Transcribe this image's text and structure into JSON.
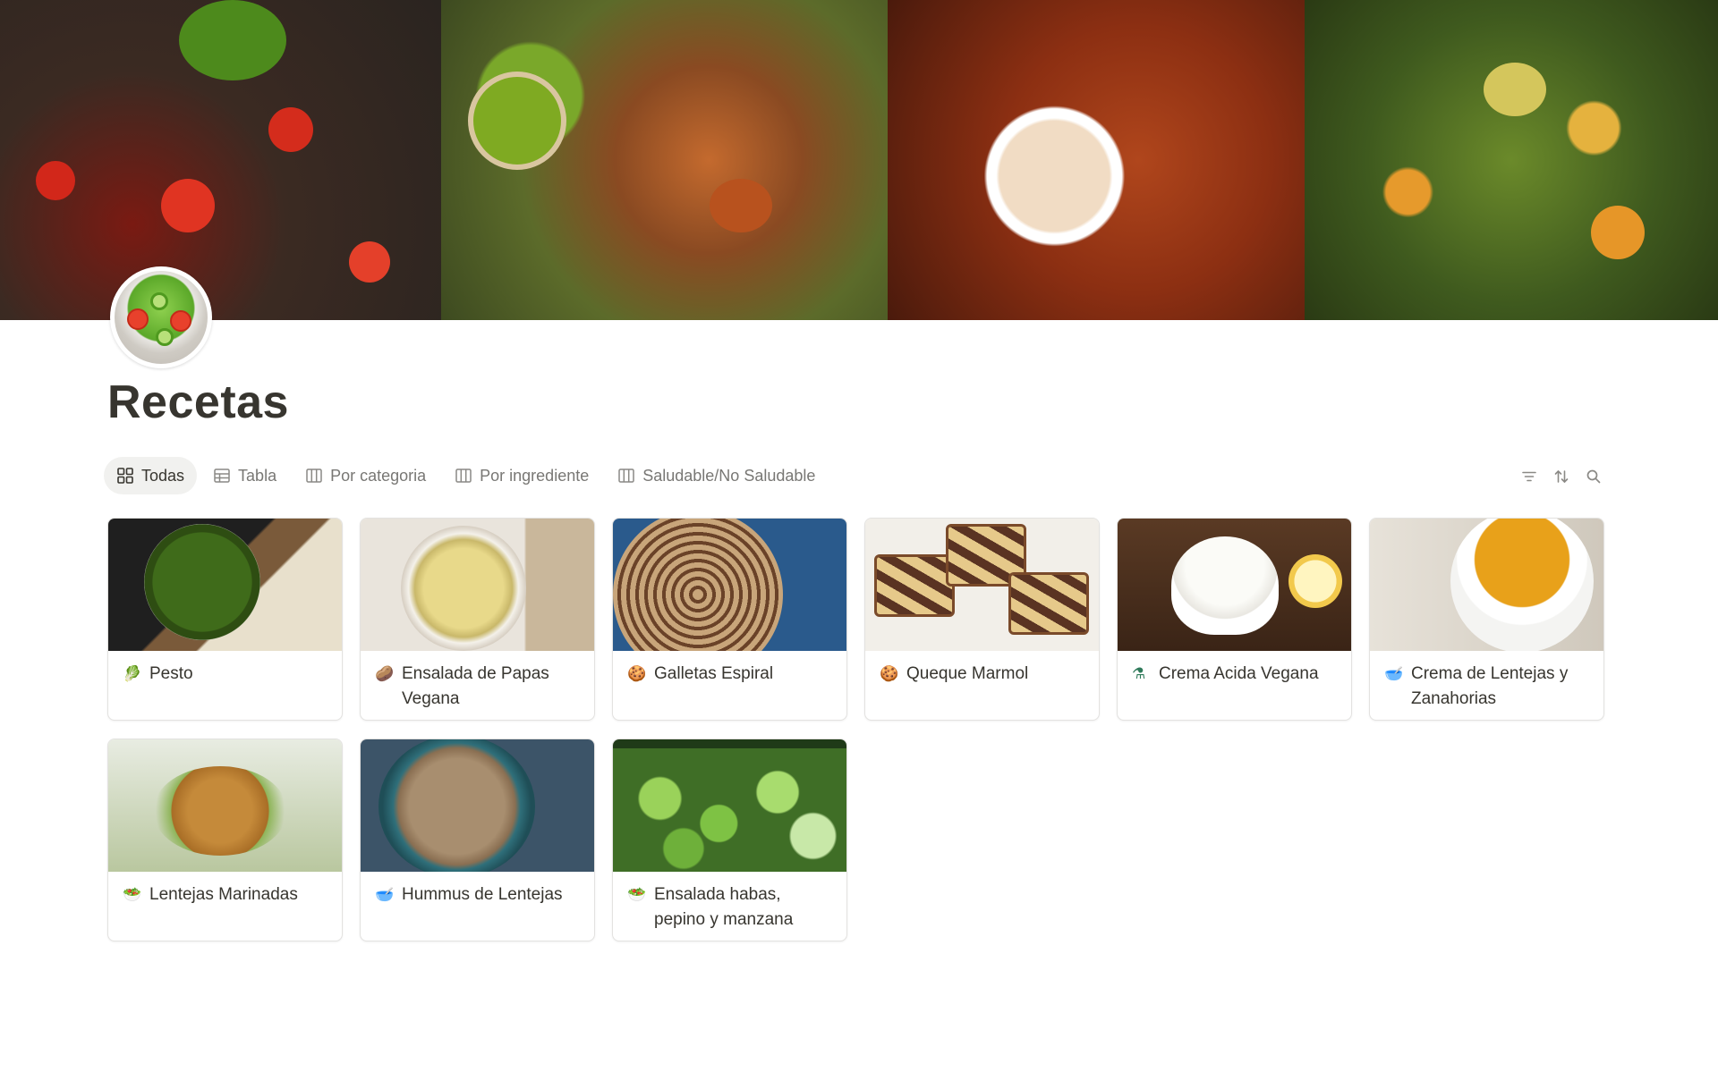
{
  "page": {
    "title": "Recetas",
    "icon": "green-salad-icon"
  },
  "views": [
    {
      "label": "Todas",
      "icon": "gallery-grid-icon",
      "active": true
    },
    {
      "label": "Tabla",
      "icon": "table-icon",
      "active": false
    },
    {
      "label": "Por categoria",
      "icon": "board-columns-icon",
      "active": false
    },
    {
      "label": "Por ingrediente",
      "icon": "board-columns-icon",
      "active": false
    },
    {
      "label": "Saludable/No Saludable",
      "icon": "board-columns-icon",
      "active": false
    }
  ],
  "toolbar": {
    "filter_icon": "filter-icon",
    "sort_icon": "sort-icon",
    "search_icon": "search-icon"
  },
  "cards": [
    {
      "title": "Pesto",
      "emoji": "🥬",
      "image": "pesto-photo"
    },
    {
      "title": "Ensalada de Papas Vegana",
      "emoji": "🥔",
      "image": "potato-salad-photo"
    },
    {
      "title": "Galletas Espiral",
      "emoji": "🍪",
      "image": "spiral-cookies-photo"
    },
    {
      "title": "Queque Marmol",
      "emoji": "🍪",
      "image": "marble-cake-photo"
    },
    {
      "title": "Crema Acida Vegana",
      "emoji": "⚗",
      "image": "sour-cream-photo"
    },
    {
      "title": "Crema de Lentejas y Zanahorias",
      "emoji": "🥣",
      "image": "lentil-carrot-soup-photo"
    },
    {
      "title": "Lentejas Marinadas",
      "emoji": "🥗",
      "image": "marinated-lentils-photo"
    },
    {
      "title": "Hummus de Lentejas",
      "emoji": "🥣",
      "image": "lentil-hummus-photo"
    },
    {
      "title": "Ensalada habas, pepino y manzana",
      "emoji": "🥗",
      "image": "fava-salad-photo"
    }
  ]
}
